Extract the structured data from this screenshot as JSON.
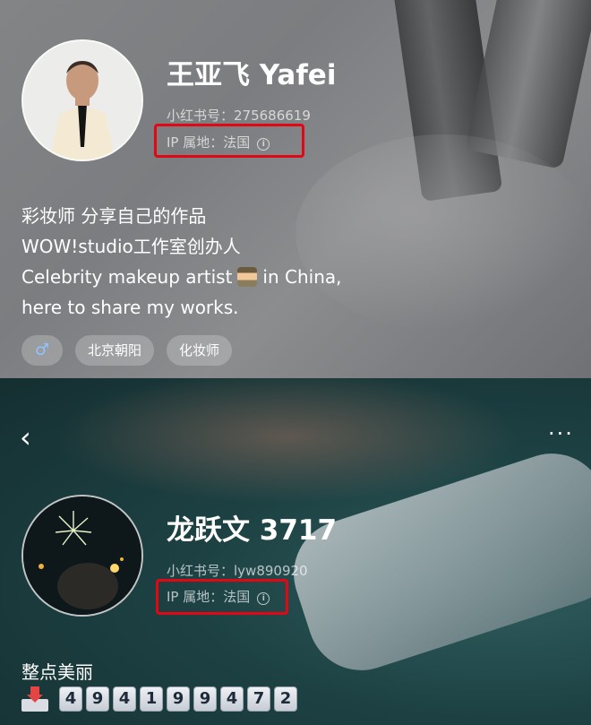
{
  "profile1": {
    "name": "王亚飞 Yafei",
    "id_line": "小红书号：275686619",
    "ip_line": "IP 属地：法国",
    "bio": [
      "彩妆师 分享自己的作品",
      "WOW!studio工作室创办人",
      "Celebrity makeup artist",
      "in China,",
      "here to share my works."
    ],
    "tags": [
      "♂",
      "北京朝阳",
      "化妆师"
    ]
  },
  "profile2": {
    "back_glyph": "‹",
    "more_glyph": "···",
    "name": "龙跃文 3717",
    "id_line": "小红书号：lyw890920",
    "ip_line": "IP 属地：法国",
    "motto": "整点美丽",
    "counter_digits": [
      "4",
      "9",
      "4",
      "1",
      "9",
      "9",
      "4",
      "7",
      "2"
    ]
  },
  "icons": {
    "info": "info-circle-icon",
    "inbox": "inbox-tray-icon",
    "back": "chevron-left-icon",
    "more": "more-dots-icon"
  },
  "colors": {
    "highlight_box": "#e30613",
    "gender_icon": "#8fc4ff"
  }
}
